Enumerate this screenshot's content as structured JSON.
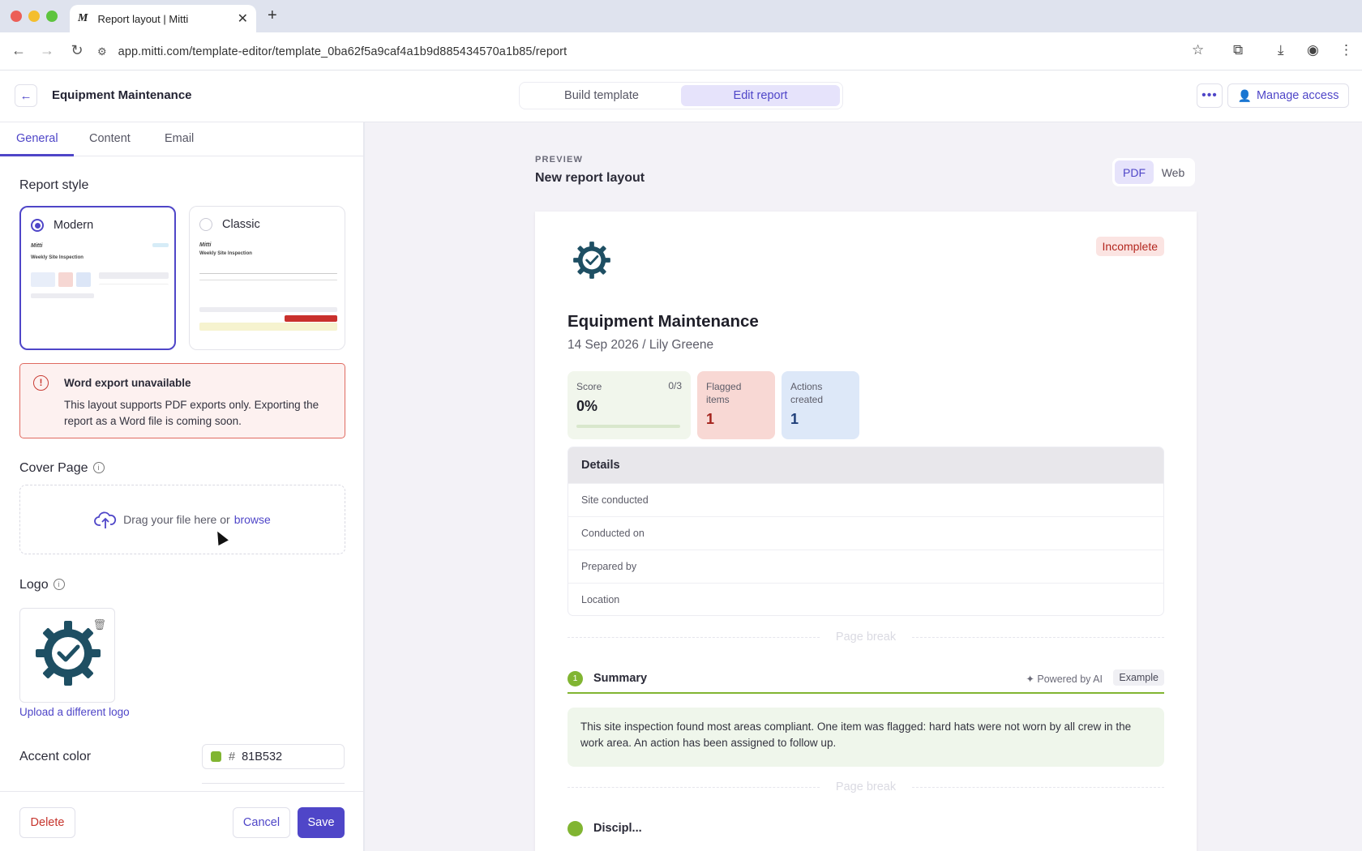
{
  "browser": {
    "tab_title": "Report layout | Mitti",
    "tab_favicon": "M",
    "url": "app.mitti.com/template-editor/template_0ba62f5a9caf4a1b9d885434570a1b85/report",
    "icons": [
      "back-arrow-icon",
      "forward-arrow-icon",
      "reload-icon",
      "site-info-icon",
      "star-icon",
      "extensions-icon",
      "download-icon",
      "profile-icon",
      "menu-dots-icon"
    ]
  },
  "header": {
    "title": "Equipment Maintenance",
    "tabs": [
      {
        "label": "Build template",
        "active": false
      },
      {
        "label": "Edit report",
        "active": true
      }
    ],
    "manage_access": "Manage access"
  },
  "panel": {
    "tabs": [
      {
        "label": "General",
        "active": true
      },
      {
        "label": "Content",
        "active": false
      },
      {
        "label": "Email",
        "active": false
      }
    ],
    "report_style_heading": "Report style",
    "styles": [
      {
        "label": "Modern",
        "selected": true,
        "thumb_title": "Weekly Site Inspection",
        "thumb_logo": "Mitti"
      },
      {
        "label": "Classic",
        "selected": false,
        "thumb_title": "Weekly Site Inspection",
        "thumb_logo": "Mitti"
      }
    ],
    "alert": {
      "title": "Word export unavailable",
      "body": "This layout supports PDF exports only. Exporting the report as a Word file is coming soon."
    },
    "cover_page": {
      "heading": "Cover Page",
      "drop_text": "Drag your file here or",
      "browse": "browse"
    },
    "logo": {
      "heading": "Logo",
      "upload_link": "Upload a different logo"
    },
    "accent": {
      "label": "Accent color",
      "hash": "#",
      "value": "81B532",
      "color": "#81B532"
    },
    "footer": {
      "delete": "Delete",
      "cancel": "Cancel",
      "save": "Save"
    }
  },
  "preview": {
    "label": "PREVIEW",
    "title": "New report layout",
    "modes": [
      {
        "label": "PDF",
        "active": true
      },
      {
        "label": "Web",
        "active": false
      }
    ],
    "report": {
      "status": "Incomplete",
      "title": "Equipment Maintenance",
      "subtitle": "14 Sep 2026 / Lily Greene",
      "stats": {
        "score_label": "Score",
        "score_value": "0%",
        "score_denom": "0/3",
        "score_fraction": 0,
        "flagged_label": "Flagged items",
        "flagged_value": "1",
        "actions_label": "Actions created",
        "actions_value": "1"
      },
      "details_heading": "Details",
      "details_rows": [
        "Site conducted",
        "Conducted on",
        "Prepared by",
        "Location"
      ],
      "page_break": "Page break",
      "summary": {
        "number": "1",
        "title": "Summary",
        "powered": "Powered by AI",
        "example": "Example",
        "body": "This site inspection found most areas compliant. One item was flagged: hard hats were not worn by all crew in the work area. An action has been assigned to follow up."
      },
      "next_section_title": "Discipl..."
    }
  }
}
